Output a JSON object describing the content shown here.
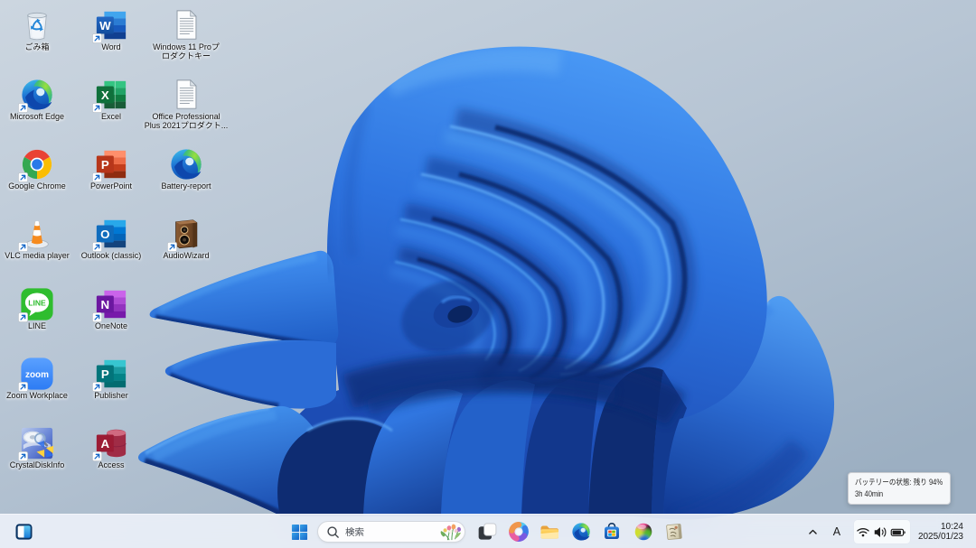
{
  "wallpaper": {
    "name": "windows-11-bloom-light",
    "palette": {
      "background_top": "#cdd7e1",
      "background_bottom": "#9fb2c4",
      "bloom_highlight": "#6fb1f5",
      "bloom_mid": "#2e74e0",
      "bloom_deep": "#1a4ab5",
      "bloom_shadow": "#0a2a78"
    }
  },
  "desktop": {
    "icons": [
      {
        "id": "recycle-bin",
        "icon": "recycle",
        "lines": [
          "ごみ箱"
        ],
        "shortcut": false,
        "col": 0,
        "row": 0
      },
      {
        "id": "microsoft-edge",
        "icon": "edge",
        "lines": [
          "Microsoft Edge"
        ],
        "shortcut": true,
        "col": 0,
        "row": 1
      },
      {
        "id": "google-chrome",
        "icon": "chrome",
        "lines": [
          "Google Chrome"
        ],
        "shortcut": true,
        "col": 0,
        "row": 2
      },
      {
        "id": "vlc-media-player",
        "icon": "vlc",
        "lines": [
          "VLC media player"
        ],
        "shortcut": true,
        "col": 0,
        "row": 3
      },
      {
        "id": "line",
        "icon": "line",
        "lines": [
          "LINE"
        ],
        "shortcut": true,
        "col": 0,
        "row": 4
      },
      {
        "id": "zoom-workplace",
        "icon": "zoom",
        "lines": [
          "Zoom Workplace"
        ],
        "shortcut": true,
        "col": 0,
        "row": 5
      },
      {
        "id": "crystaldiskinfo",
        "icon": "crystal",
        "lines": [
          "CrystalDiskInfo"
        ],
        "shortcut": true,
        "col": 0,
        "row": 6
      },
      {
        "id": "word",
        "icon": "word",
        "lines": [
          "Word"
        ],
        "shortcut": true,
        "col": 1,
        "row": 0
      },
      {
        "id": "excel",
        "icon": "excel",
        "lines": [
          "Excel"
        ],
        "shortcut": true,
        "col": 1,
        "row": 1
      },
      {
        "id": "powerpoint",
        "icon": "powerpoint",
        "lines": [
          "PowerPoint"
        ],
        "shortcut": true,
        "col": 1,
        "row": 2
      },
      {
        "id": "outlook-classic",
        "icon": "outlook",
        "lines": [
          "Outlook (classic)"
        ],
        "shortcut": true,
        "col": 1,
        "row": 3
      },
      {
        "id": "onenote",
        "icon": "onenote",
        "lines": [
          "OneNote"
        ],
        "shortcut": true,
        "col": 1,
        "row": 4
      },
      {
        "id": "publisher",
        "icon": "publisher",
        "lines": [
          "Publisher"
        ],
        "shortcut": true,
        "col": 1,
        "row": 5
      },
      {
        "id": "access",
        "icon": "access",
        "lines": [
          "Access"
        ],
        "shortcut": true,
        "col": 1,
        "row": 6
      },
      {
        "id": "windows11-pro-product-key",
        "icon": "txtdoc",
        "lines": [
          "Windows 11 Proプ",
          "ロダクトキー"
        ],
        "shortcut": false,
        "col": 2,
        "row": 0
      },
      {
        "id": "office-product-key",
        "icon": "txtdoc",
        "lines": [
          "Office Professional",
          "Plus 2021プロダクト..."
        ],
        "shortcut": false,
        "col": 2,
        "row": 1
      },
      {
        "id": "battery-report",
        "icon": "edge",
        "lines": [
          "Battery-report"
        ],
        "shortcut": false,
        "col": 2,
        "row": 2
      },
      {
        "id": "audiowizard",
        "icon": "audiowizard",
        "lines": [
          "AudioWizard"
        ],
        "shortcut": true,
        "col": 2,
        "row": 3
      }
    ]
  },
  "tooltip": {
    "line1": "バッテリーの状態: 残り 94%",
    "line2": "3h 40min"
  },
  "taskbar": {
    "widgets_button": {
      "icon": "widgets"
    },
    "start_button": {
      "icon": "start"
    },
    "search": {
      "placeholder": "検索"
    },
    "pinned": [
      {
        "id": "task-view",
        "icon": "taskview"
      },
      {
        "id": "copilot",
        "icon": "copilot"
      },
      {
        "id": "file-explorer",
        "icon": "explorer"
      },
      {
        "id": "edge-taskbar",
        "icon": "edgetb"
      },
      {
        "id": "microsoft-store",
        "icon": "store"
      },
      {
        "id": "color-sphere-app",
        "icon": "sphere"
      },
      {
        "id": "hagaki-app",
        "icon": "hagaki"
      }
    ],
    "tray": {
      "ime_mode": "A",
      "time": "10:24",
      "date": "2025/01/23"
    }
  }
}
